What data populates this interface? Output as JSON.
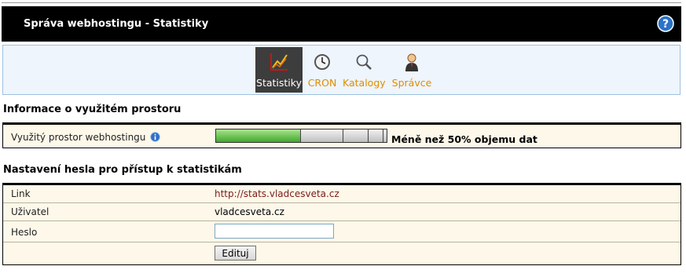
{
  "header": {
    "title": "Správa webhostingu - Statistiky",
    "help_icon": "help-icon"
  },
  "toolbar": {
    "items": [
      {
        "label": "Statistiky",
        "icon": "chart-icon",
        "active": true
      },
      {
        "label": "CRON",
        "icon": "clock-icon",
        "active": false
      },
      {
        "label": "Katalogy",
        "icon": "magnifier-icon",
        "active": false
      },
      {
        "label": "Správce",
        "icon": "admin-user-icon",
        "active": false
      }
    ]
  },
  "usage": {
    "heading": "Informace o využitém prostoru",
    "label": "Využitý prostor webhostingu",
    "status": "Méně než 50% objemu dat",
    "segments_total": 5,
    "segments_filled": 1
  },
  "password": {
    "heading": "Nastavení hesla pro přístup k statistikám",
    "link_label": "Link",
    "link_value": "http://stats.vladcesveta.cz",
    "user_label": "Uživatel",
    "user_value": "vladcesveta.cz",
    "password_label": "Heslo",
    "password_value": "",
    "edit_button": "Edituj"
  },
  "colors": {
    "header_bg": "#000000",
    "toolbar_label": "#e08d00",
    "link": "#7b1a1a",
    "table_bg": "#fdf8e9",
    "progress_fill": "#41a82c"
  }
}
